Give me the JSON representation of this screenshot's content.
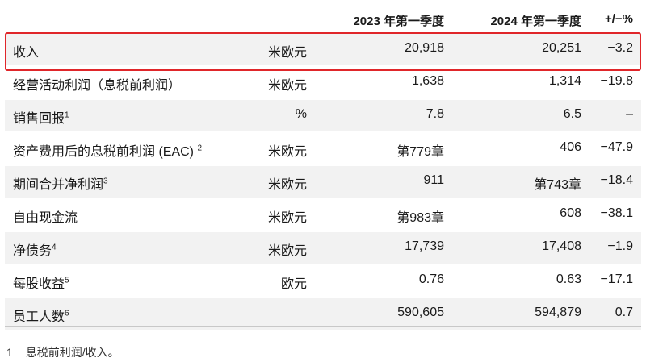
{
  "header": {
    "col_2023": "2023 年第一季度",
    "col_2024": "2024 年第一季度",
    "col_delta": "+/−%"
  },
  "rows": [
    {
      "label": "收入",
      "sup": "",
      "unit": "米欧元",
      "v2023": "20,918",
      "v2024": "20,251",
      "delta": "−3.2"
    },
    {
      "label": "经营活动利润（息税前利润）",
      "sup": "",
      "unit": "米欧元",
      "v2023": "1,638",
      "v2024": "1,314",
      "delta": "−19.8"
    },
    {
      "label": "销售回报",
      "sup": "1",
      "unit": "%",
      "v2023": "7.8",
      "v2024": "6.5",
      "delta": "–"
    },
    {
      "label": "资产费用后的息税前利润 (EAC)",
      "sup": "2",
      "unit": "米欧元",
      "v2023": "第779章",
      "v2024": "406",
      "delta": "−47.9"
    },
    {
      "label": "期间合并净利润",
      "sup": "3",
      "unit": "米欧元",
      "v2023": "911",
      "v2024": "第743章",
      "delta": "−18.4"
    },
    {
      "label": "自由现金流",
      "sup": "",
      "unit": "米欧元",
      "v2023": "第983章",
      "v2024": "608",
      "delta": "−38.1"
    },
    {
      "label": "净债务",
      "sup": "4",
      "unit": "米欧元",
      "v2023": "17,739",
      "v2024": "17,408",
      "delta": "−1.9"
    },
    {
      "label": "每股收益",
      "sup": "5",
      "unit": "欧元",
      "v2023": "0.76",
      "v2024": "0.63",
      "delta": "−17.1"
    },
    {
      "label": "员工人数",
      "sup": "6",
      "unit": "",
      "v2023": "590,605",
      "v2024": "594,879",
      "delta": "0.7"
    }
  ],
  "footnote": {
    "number": "1",
    "text": "息税前利润/收入。"
  },
  "colors": {
    "highlight_border": "#e0262a",
    "row_shade": "#f2f2f2"
  }
}
